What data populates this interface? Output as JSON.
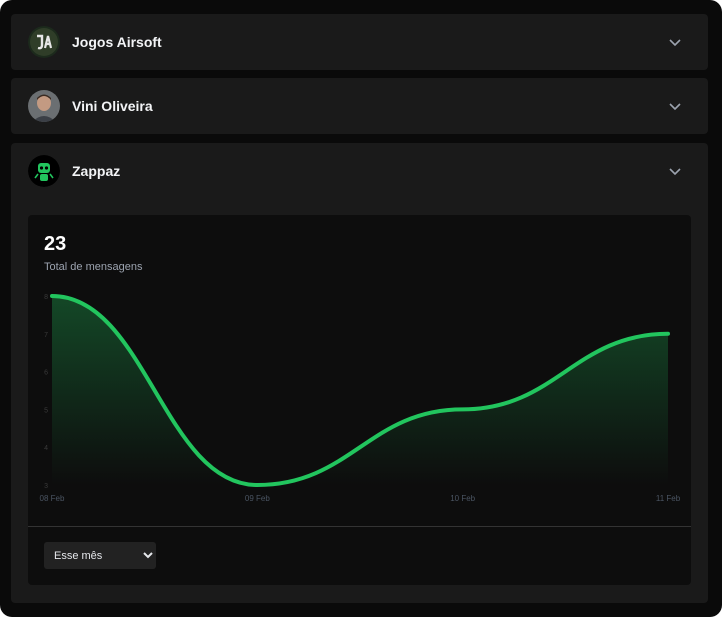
{
  "accounts": [
    {
      "name": "Jogos Airsoft",
      "avatar_icon": "ja-logo-icon"
    },
    {
      "name": "Vini Oliveira",
      "avatar_icon": "person-photo-icon"
    },
    {
      "name": "Zappaz",
      "avatar_icon": "robot-logo-icon"
    }
  ],
  "stats": {
    "total": "23",
    "total_label": "Total de mensagens"
  },
  "period": {
    "selected": "Esse mês"
  },
  "colors": {
    "accent": "#22c55e",
    "background": "#0a0a0a",
    "panel": "#1a1a1a"
  },
  "chart_data": {
    "type": "area",
    "categories": [
      "08 Feb",
      "09 Feb",
      "10 Feb",
      "11 Feb"
    ],
    "values": [
      8,
      3,
      5,
      7
    ],
    "ylim": [
      3,
      8
    ],
    "y_ticks": [
      "3",
      "4",
      "5",
      "6",
      "7",
      "8"
    ],
    "grid": false
  }
}
